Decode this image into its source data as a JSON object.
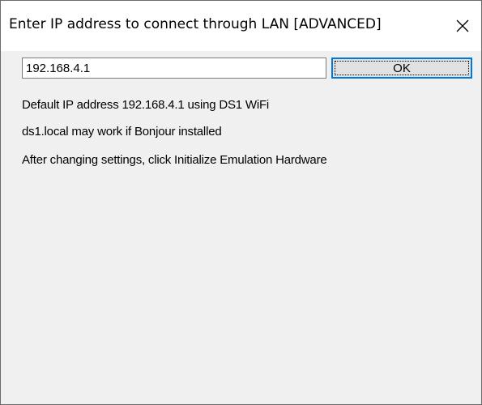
{
  "window": {
    "title": "Enter IP address to connect through LAN [ADVANCED]",
    "close_symbol": "✕"
  },
  "form": {
    "ip_value": "192.168.4.1",
    "ok_label": "OK"
  },
  "info": {
    "line1": "Default IP address 192.168.4.1 using DS1 WiFi",
    "line2": "ds1.local may work if Bonjour installed",
    "line3": "After changing settings, click Initialize Emulation Hardware"
  },
  "colors": {
    "title_bg": "#ffffff",
    "client_bg": "#f0f0f0",
    "focus_accent": "#0078d7"
  },
  "icons": {
    "close": "close-icon"
  }
}
